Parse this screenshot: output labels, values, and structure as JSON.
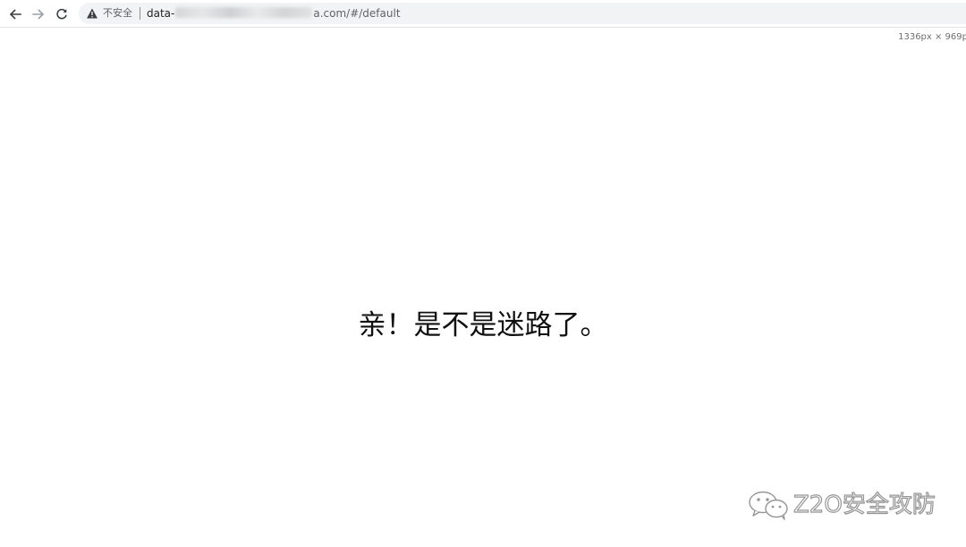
{
  "browser": {
    "security_label": "不安全",
    "url_prefix": "data-",
    "url_suffix": "a.com/#/default",
    "viewport_dims": "1336px × 969p"
  },
  "page": {
    "message": "亲！是不是迷路了。"
  },
  "watermark": {
    "text": "Z2O安全攻防"
  },
  "colors": {
    "text_main": "#111111",
    "omnibox_bg": "#f1f3f4",
    "icon_gray": "#5f6368"
  }
}
